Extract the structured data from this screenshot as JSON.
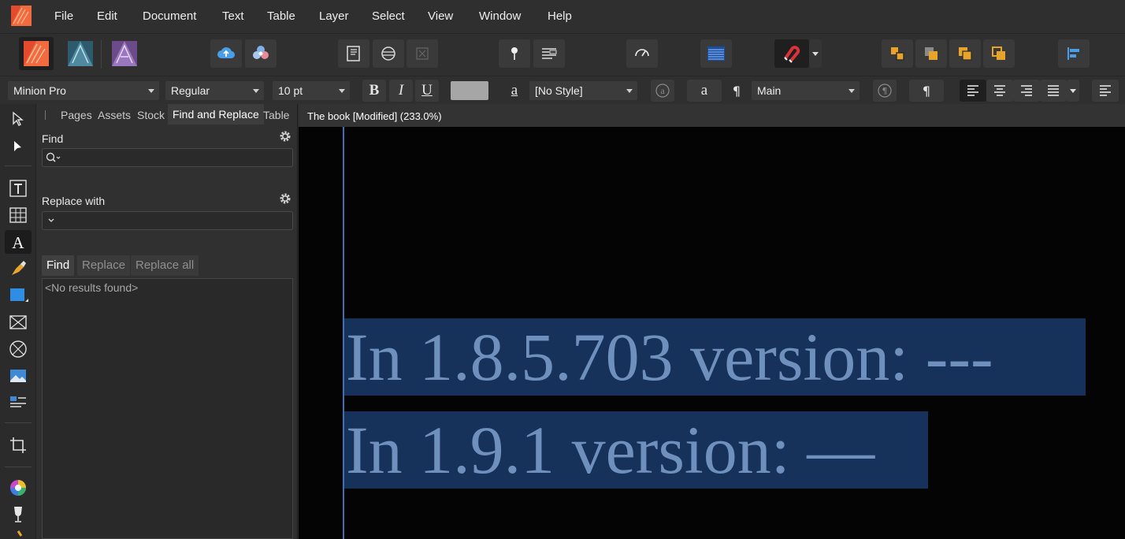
{
  "menubar": {
    "items": [
      "File",
      "Edit",
      "Document",
      "Text",
      "Table",
      "Layer",
      "Select",
      "View",
      "Window",
      "Help"
    ]
  },
  "context_bar": {
    "font_family": "Minion Pro",
    "font_style": "Regular",
    "font_size": "10 pt",
    "char_style": "[No Style]",
    "para_style": "Main"
  },
  "panel": {
    "tabs": [
      "Pages",
      "Assets",
      "Stock",
      "Find and Replace",
      "Table"
    ],
    "active_tab": "Find and Replace",
    "find_label": "Find",
    "replace_label": "Replace with",
    "buttons": {
      "find": "Find",
      "replace": "Replace",
      "replace_all": "Replace all"
    },
    "results_text": "<No results found>"
  },
  "document": {
    "title": "The book [Modified] (233.0%)",
    "lines": [
      "In 1.8.5.703 version: ---",
      "In 1.9.1 version: —"
    ]
  },
  "colors": {
    "selection": "#17325a",
    "text": "#6f8fbc",
    "canvas": "#050404",
    "margin_guide": "#3e6fb3"
  }
}
